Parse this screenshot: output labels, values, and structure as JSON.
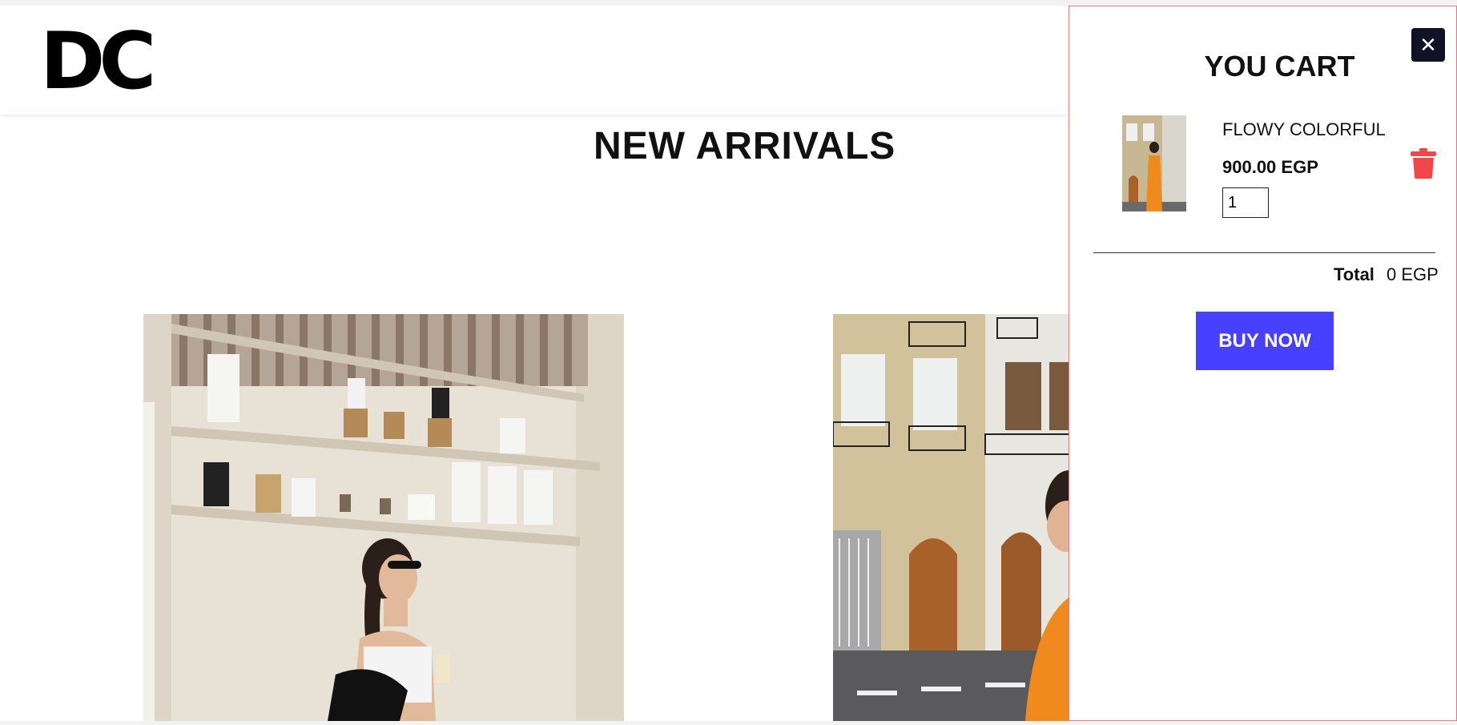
{
  "header": {
    "logo": "DC"
  },
  "main": {
    "section_title": "NEW ARRIVALS"
  },
  "cart": {
    "title": "YOU CART",
    "close_label": "✕",
    "item": {
      "name": "FLOWY COLORFUL",
      "price": "900.00 EGP",
      "quantity": "1"
    },
    "total_label": "Total",
    "total_value": "0 EGP",
    "buy_label": "BUY NOW"
  },
  "colors": {
    "buy_button": "#4740ff",
    "trash_icon": "#f04848",
    "close_button": "#111127",
    "cart_border": "#e8797d"
  }
}
